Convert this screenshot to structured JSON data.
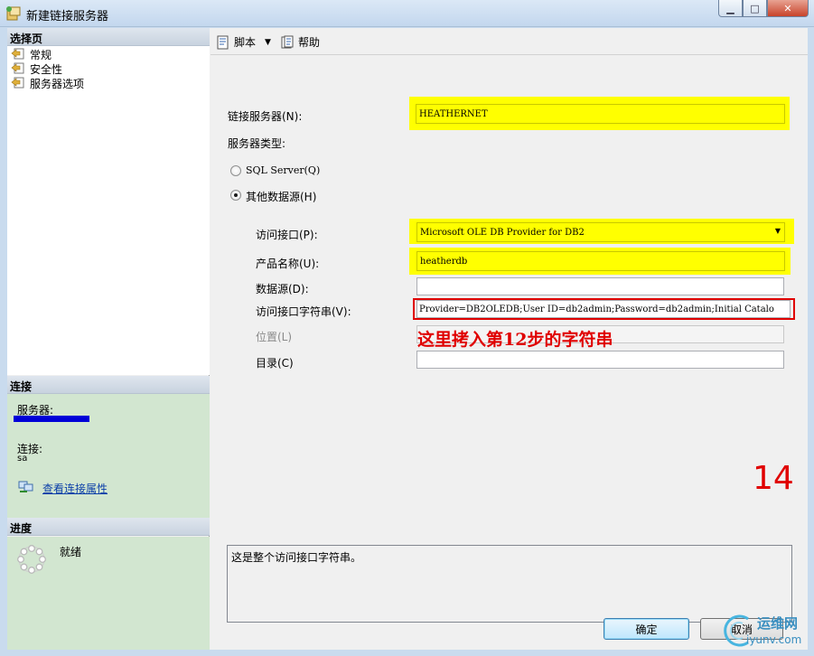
{
  "window": {
    "title": "新建链接服务器",
    "icon": "linked-server-window-icon",
    "controls": {
      "minimize": "▁",
      "maximize": "□",
      "close": "✕"
    }
  },
  "left_pane": {
    "select_page_header": "选择页",
    "pages": [
      {
        "label": "常规",
        "icon": "page-icon"
      },
      {
        "label": "安全性",
        "icon": "page-icon"
      },
      {
        "label": "服务器选项",
        "icon": "page-icon"
      }
    ],
    "connection": {
      "header": "连接",
      "server_label": "服务器:",
      "server_value_redacted": true,
      "redaction_color": "#0000d8",
      "connection_label": "连接:",
      "connection_value": "sa",
      "view_properties_link": "查看连接属性"
    },
    "progress": {
      "header": "进度",
      "status": "就绪"
    }
  },
  "toolbar": {
    "script_label": "脚本",
    "help_label": "帮助"
  },
  "form": {
    "linked_server_label": "链接服务器(N):",
    "linked_server_value": "HEATHERNET",
    "server_type_label": "服务器类型:",
    "radio_sql_server": "SQL Server(Q)",
    "radio_other": "其他数据源(H)",
    "selected_radio": "other",
    "provider_label": "访问接口(P):",
    "provider_value": "Microsoft OLE DB Provider for DB2",
    "product_name_label": "产品名称(U):",
    "product_name_value": "heatherdb",
    "data_source_label": "数据源(D):",
    "data_source_value": "",
    "provider_string_label": "访问接口字符串(V):",
    "provider_string_value": "Provider=DB2OLEDB;User ID=db2admin;Password=db2admin;Initial Catalo",
    "location_label": "位置(L)",
    "location_value": "",
    "catalog_label": "目录(C)",
    "catalog_value": ""
  },
  "annotations": {
    "paste_hint": "这里拷入第12步的字符串",
    "step_number": "14",
    "highlight_color": "#ffff00",
    "annotation_red": "#e00000"
  },
  "description": {
    "text": "这是整个访问接口字符串。"
  },
  "buttons": {
    "ok": "确定",
    "cancel": "取消"
  },
  "watermark": {
    "cn": "运维网",
    "url": "iyunv.com"
  }
}
